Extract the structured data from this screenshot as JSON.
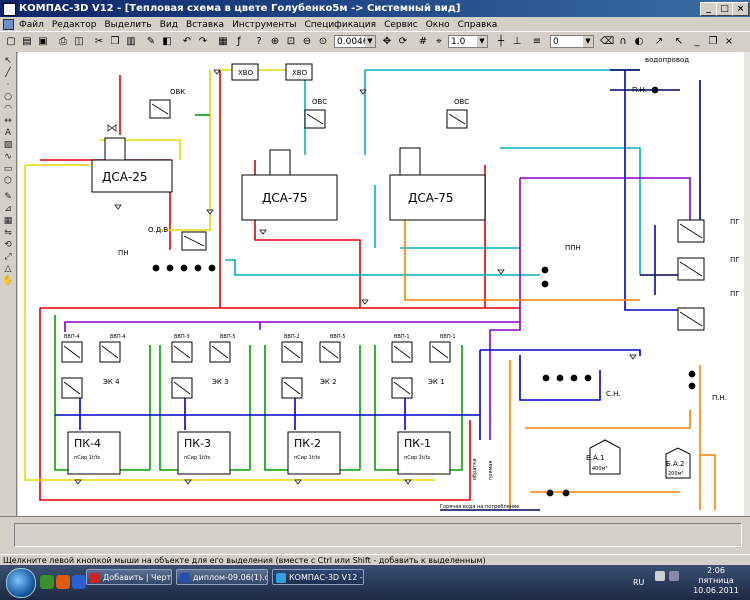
{
  "window": {
    "title": "КОМПАС-3D V12 - [Тепловая схема в цвете Голубенко5м -> Системный вид]",
    "minimize": "_",
    "maximize": "□",
    "close": "×"
  },
  "menu": [
    "Файл",
    "Редактор",
    "Выделить",
    "Вид",
    "Вставка",
    "Инструменты",
    "Спецификация",
    "Сервис",
    "Окно",
    "Справка"
  ],
  "toolbar": {
    "zoom": "0.0046",
    "step": "1.0",
    "layer": "0"
  },
  "diagram": {
    "labels": {
      "xvo1": "ХВО",
      "xvo2": "ХВО",
      "vodoprovod": "водопровод",
      "ovk": "ОВК",
      "ovs1": "ОВС",
      "ovs2": "ОВС",
      "dsa25": "ДСА-25",
      "dsa75a": "ДСА-75",
      "dsa75b": "ДСА-75",
      "odv": "О.Д.В",
      "pn": "ПН",
      "ppn": "ППН",
      "pn_top": "П.Н.",
      "pn_right": "П.Н.",
      "sn": "С.Н.",
      "pg1": "ПГ",
      "pg2": "ПГ",
      "pg3": "ПГ",
      "ek4": "ЭК 4",
      "ek3": "ЭК 3",
      "ek2": "ЭК 2",
      "ek1": "ЭК 1",
      "pk4": "ПК-4",
      "pk3": "ПК-3",
      "pk2": "ПК-2",
      "pk1": "ПК-1",
      "pk_sub": "пСир 1t/ts",
      "vvp4a": "ВВП-4",
      "vvp4b": "ВВП-4",
      "vvp3a": "ВВП-3",
      "vvp3b": "ВВП-5",
      "vvp2a": "ВВП-2",
      "vvp2b": "ВВП-5",
      "vvp1a": "ВВП-1",
      "vvp1b": "ВВП-1",
      "ba1": "Б.А.1",
      "ba1_sub": "400м³",
      "ba2": "Б.А.2",
      "ba2_sub": "200м³",
      "obratka": "обратка",
      "pryamaya": "прямая",
      "gw": "Горячая вода на потребление"
    }
  },
  "status": {
    "hint": "Щелкните левой кнопкой мыши на объекте для его выделения (вместе с Ctrl или Shift - добавить к выделенным)"
  },
  "taskbar": {
    "tasks": [
      "Добавить | Черте...",
      "диплом-09.06(1).d...",
      "КОМПАС-3D V12 - ..."
    ],
    "lang": "RU",
    "time": "2:06",
    "day": "пятница",
    "date": "10.06.2011"
  }
}
